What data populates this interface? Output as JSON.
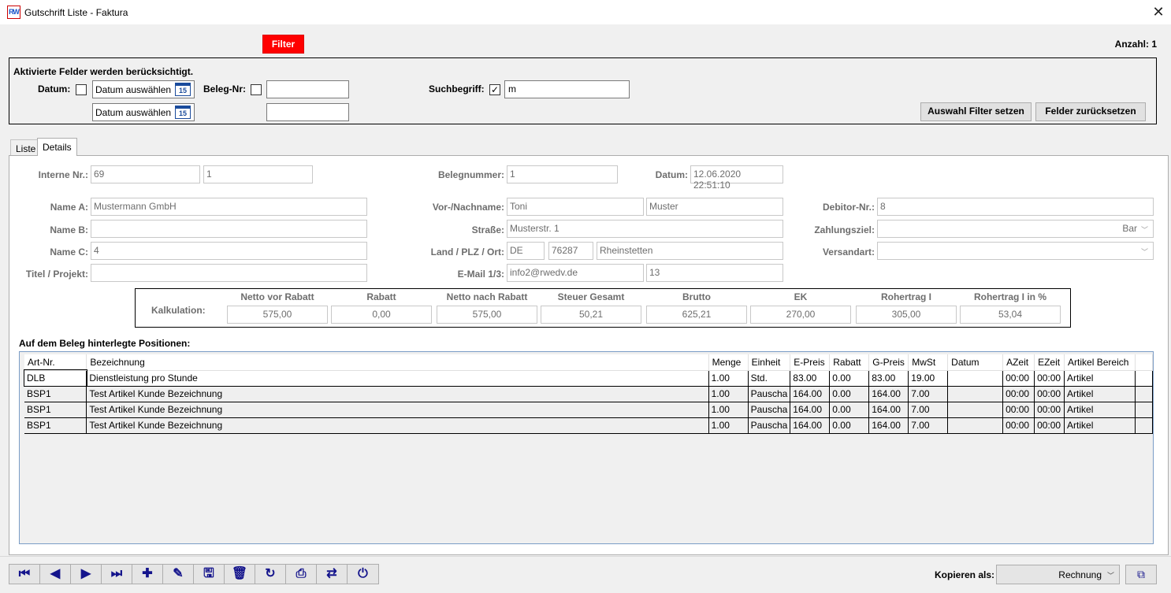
{
  "window": {
    "title": "Gutschrift Liste - Faktura",
    "app_icon_text": "RW",
    "close": "✕"
  },
  "filter": {
    "button_label": "Filter",
    "count_label": "Anzahl: 1",
    "heading": "Aktivierte Felder werden berücksichtigt.",
    "datum_label": "Datum:",
    "date_from_placeholder": "Datum auswählen",
    "date_to_placeholder": "Datum auswählen",
    "calendar_day": "15",
    "beleg_label": "Beleg-Nr:",
    "beleg_from": "",
    "beleg_to": "",
    "suchbegriff_label": "Suchbegriff:",
    "suchbegriff_checked": "✓",
    "suchbegriff_value": "m",
    "apply_button": "Auswahl Filter setzen",
    "reset_button": "Felder zurücksetzen"
  },
  "tabs": [
    {
      "label": "Liste"
    },
    {
      "label": "Details"
    }
  ],
  "details": {
    "interne_label": "Interne Nr.:",
    "interne_nr": "69",
    "interne_nr2": "1",
    "belegnummer_label": "Belegnummer:",
    "belegnummer": "1",
    "datum_label": "Datum:",
    "datum": "12.06.2020 22:51:10",
    "name_a_label": "Name A:",
    "name_a": "Mustermann GmbH",
    "name_b_label": "Name B:",
    "name_b": "",
    "name_c_label": "Name C:",
    "name_c": "4",
    "titel_label": "Titel / Projekt:",
    "titel": "",
    "vorname_label": "Vor-/Nachname:",
    "vorname": "Toni",
    "nachname": "Muster",
    "strasse_label": "Straße:",
    "strasse": "Musterstr. 1",
    "land_label": "Land / PLZ / Ort:",
    "land": "DE",
    "plz": "76287",
    "ort": "Rheinstetten",
    "email_label": "E-Mail 1/3:",
    "email1": "info2@rwedv.de",
    "email3": "13",
    "debitor_label": "Debitor-Nr.:",
    "debitor": "8",
    "zahlungsziel_label": "Zahlungsziel:",
    "zahlungsziel": "Bar",
    "versandart_label": "Versandart:",
    "versandart": ""
  },
  "kalkulation": {
    "label": "Kalkulation:",
    "columns": [
      {
        "head": "Netto vor Rabatt",
        "value": "575,00"
      },
      {
        "head": "Rabatt",
        "value": "0,00"
      },
      {
        "head": "Netto nach Rabatt",
        "value": "575,00"
      },
      {
        "head": "Steuer Gesamt",
        "value": "50,21"
      },
      {
        "head": "Brutto",
        "value": "625,21"
      },
      {
        "head": "EK",
        "value": "270,00"
      },
      {
        "head": "Rohertrag I",
        "value": "305,00"
      },
      {
        "head": "Rohertrag I in %",
        "value": "53,04"
      }
    ]
  },
  "positions": {
    "heading": "Auf dem Beleg hinterlegte Positionen:",
    "columns": [
      "Art-Nr.",
      "Bezeichnung",
      "Menge",
      "Einheit",
      "E-Preis",
      "Rabatt",
      "G-Preis",
      "MwSt",
      "Datum",
      "AZeit",
      "EZeit",
      "Artikel Bereich"
    ],
    "rows": [
      [
        "DLB",
        "Dienstleistung pro Stunde",
        "1.00",
        "Std.",
        "83.00",
        "0.00",
        "83.00",
        "19.00",
        "",
        "00:00",
        "00:00",
        "Artikel"
      ],
      [
        "BSP1",
        "Test Artikel Kunde Bezeichnung",
        "1.00",
        "Pauscha",
        "164.00",
        "0.00",
        "164.00",
        "7.00",
        "",
        "00:00",
        "00:00",
        "Artikel"
      ],
      [
        "BSP1",
        "Test Artikel Kunde Bezeichnung",
        "1.00",
        "Pauscha",
        "164.00",
        "0.00",
        "164.00",
        "7.00",
        "",
        "00:00",
        "00:00",
        "Artikel"
      ],
      [
        "BSP1",
        "Test Artikel Kunde Bezeichnung",
        "1.00",
        "Pauscha",
        "164.00",
        "0.00",
        "164.00",
        "7.00",
        "",
        "00:00",
        "00:00",
        "Artikel"
      ]
    ]
  },
  "footer": {
    "nav": [
      {
        "icon": "first-record-icon",
        "glyph": "⏮"
      },
      {
        "icon": "previous-record-icon",
        "glyph": "◀"
      },
      {
        "icon": "next-record-icon",
        "glyph": "▶"
      },
      {
        "icon": "last-record-icon",
        "glyph": "⏭"
      },
      {
        "icon": "add-icon",
        "glyph": "✚"
      },
      {
        "icon": "edit-icon",
        "glyph": "✎"
      },
      {
        "icon": "save-icon",
        "glyph": "🖫"
      },
      {
        "icon": "delete-icon",
        "glyph": "🗑"
      },
      {
        "icon": "refresh-icon",
        "glyph": "↻"
      },
      {
        "icon": "print-icon",
        "glyph": "⎙"
      },
      {
        "icon": "sync-icon",
        "glyph": "⇄"
      },
      {
        "icon": "power-icon",
        "glyph": "⏻"
      }
    ],
    "kopieren_label": "Kopieren als:",
    "kopieren_value": "Rechnung",
    "copy_glyph": "⧉"
  }
}
